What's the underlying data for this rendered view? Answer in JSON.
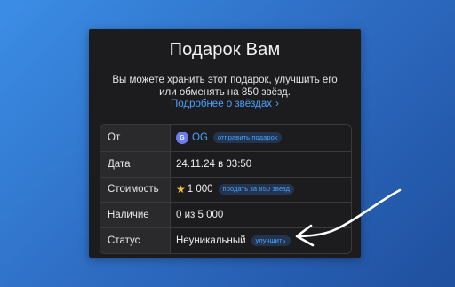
{
  "panel": {
    "title": "Подарок Вам",
    "description": "Вы можете хранить этот подарок, улучшить его или обменять на 850 звёзд.",
    "link": "Подробнее о звёздах",
    "link_chevron": "›"
  },
  "rows": {
    "from": {
      "label": "От",
      "avatar_letter": "G",
      "name": "OG",
      "action": "отправить подарок"
    },
    "date": {
      "label": "Дата",
      "value": "24.11.24 в 03:50"
    },
    "cost": {
      "label": "Стоимость",
      "star": "★",
      "value": "1 000",
      "action": "продать за 850 звёзд"
    },
    "availability": {
      "label": "Наличие",
      "value": "0 из 5 000"
    },
    "status": {
      "label": "Статус",
      "value": "Неуникальный",
      "action": "улучшить"
    }
  },
  "colors": {
    "accent": "#4aa3ff",
    "panel_bg": "#1c1c1e",
    "annotation": "#ffffff"
  }
}
